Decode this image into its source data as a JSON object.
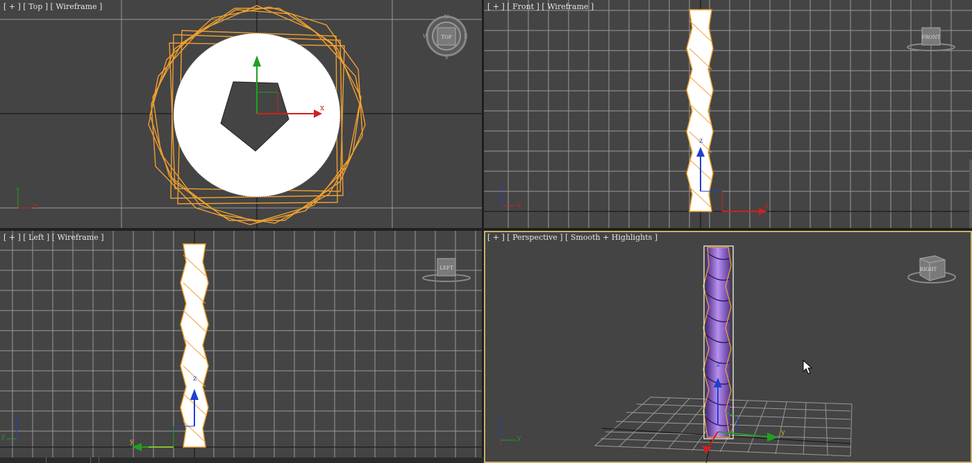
{
  "viewports": {
    "top": {
      "plus": "[ + ]",
      "view": "[ Top ]",
      "shading": "[ Wireframe ]",
      "cube_label": "TOP"
    },
    "front": {
      "plus": "[ + ]",
      "view": "[ Front ]",
      "shading": "[ Wireframe ]",
      "cube_label": "FRONT"
    },
    "left": {
      "plus": "[ + ]",
      "view": "[ Left ]",
      "shading": "[ Wireframe ]",
      "cube_label": "LEFT"
    },
    "perspective": {
      "plus": "[ + ]",
      "view": "[ Perspective ]",
      "shading": "[ Smooth + Highlights ]",
      "cube_label": "RIGHT"
    }
  },
  "axes": {
    "x": "x",
    "y": "y",
    "z": "z"
  },
  "compass": {
    "n": "N",
    "s": "S",
    "e": "E",
    "w": "W"
  },
  "colors": {
    "viewport_bg": "#444444",
    "grid": "#9a9a9a",
    "selection": "#f0a030",
    "active_border": "#c8b46a",
    "axis_x": "#d02020",
    "axis_y": "#20a020",
    "axis_z": "#2040d0",
    "mesh_purple": "#8a5ad0"
  }
}
